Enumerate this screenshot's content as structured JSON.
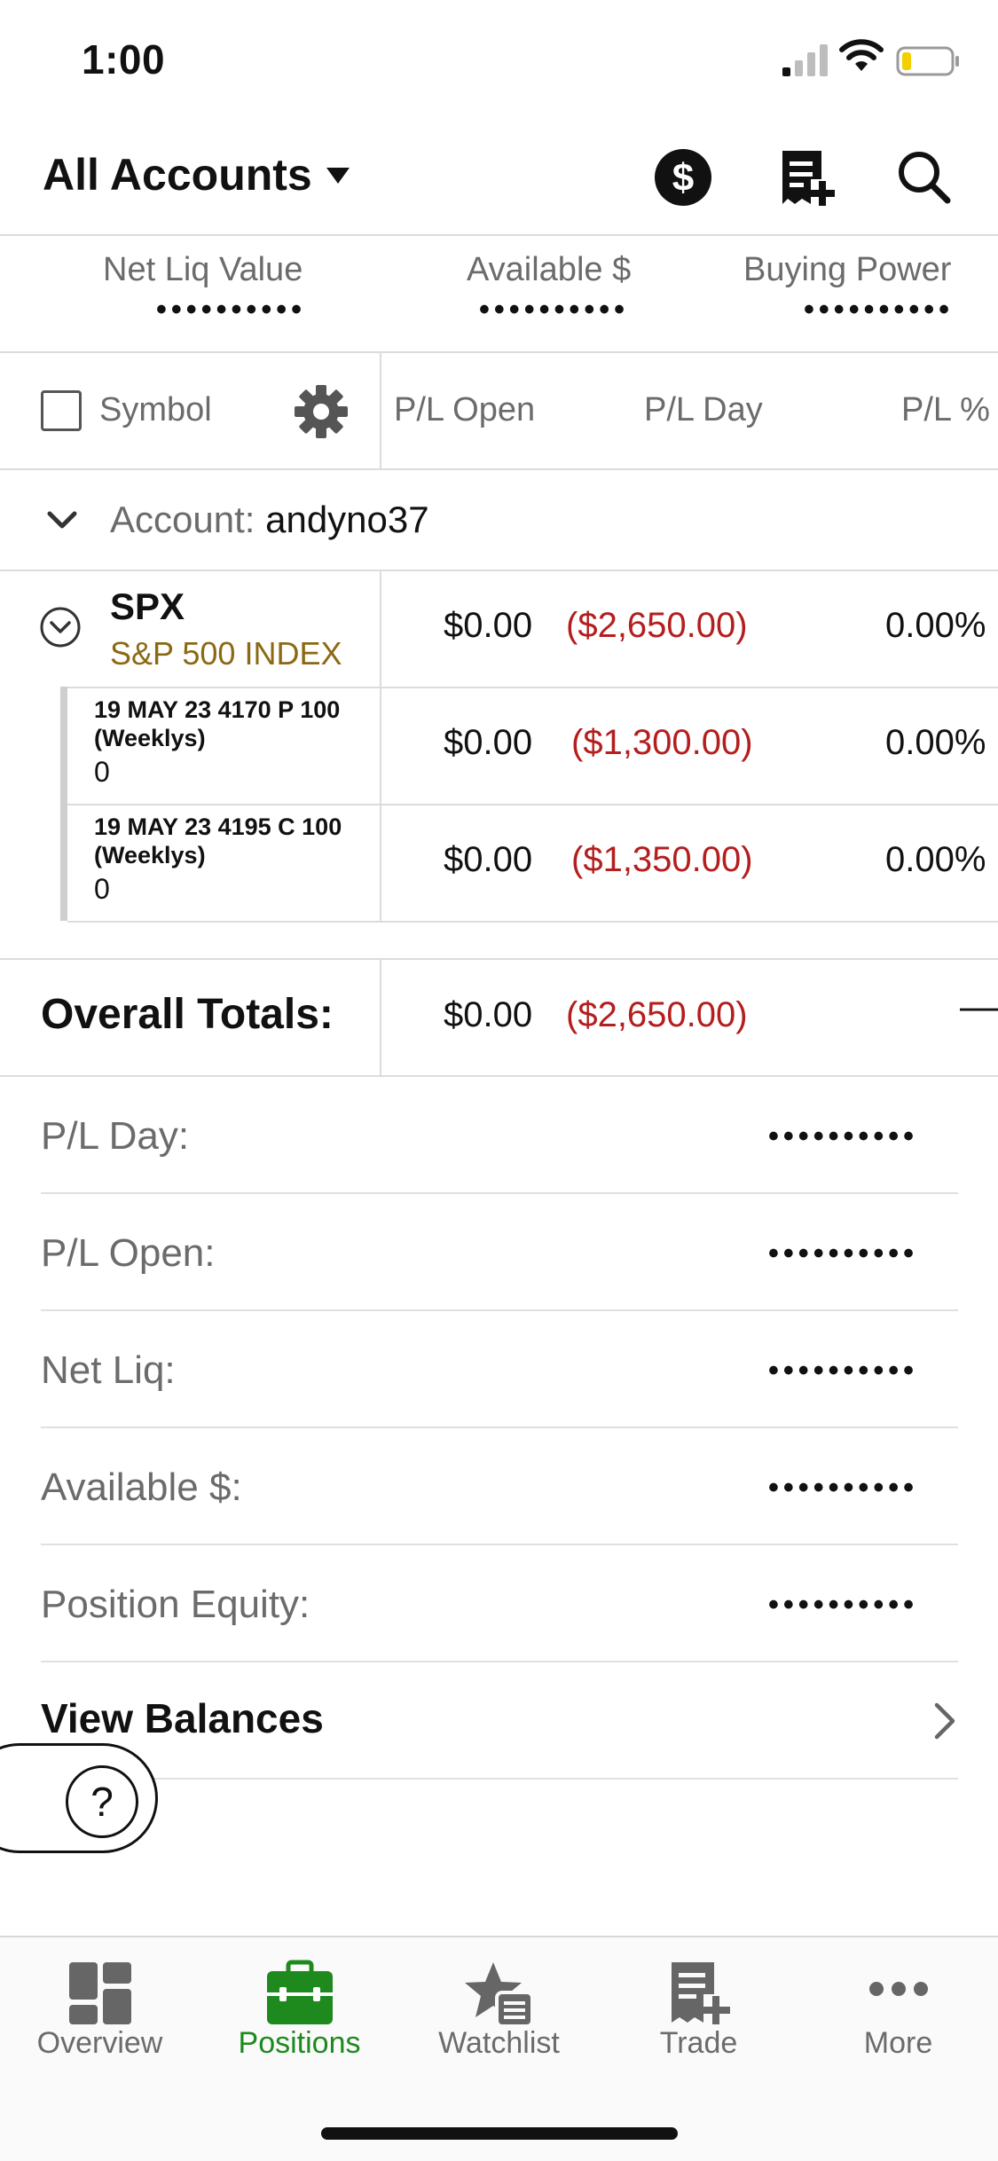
{
  "status_bar": {
    "time": "1:00"
  },
  "header": {
    "account_selector": "All Accounts"
  },
  "summary": [
    {
      "label": "Net Liq Value",
      "value": "••••••••••"
    },
    {
      "label": "Available $",
      "value": "••••••••••"
    },
    {
      "label": "Buying Power",
      "value": "••••••••••"
    }
  ],
  "columns": {
    "symbol": "Symbol",
    "pl_open": "P/L Open",
    "pl_day": "P/L Day",
    "pl_pct": "P/L %"
  },
  "account_row": {
    "prefix": "Account:",
    "name": "andyno37"
  },
  "position": {
    "symbol": "SPX",
    "description": "S&P 500 INDEX",
    "pl_open": "$0.00",
    "pl_day": "($2,650.00)",
    "pl_pct": "0.00%"
  },
  "legs": [
    {
      "title_line1": "19 MAY 23 4170 P 100",
      "title_line2": "(Weeklys)",
      "qty": "0",
      "pl_open": "$0.00",
      "pl_day": "($1,300.00)",
      "pl_pct": "0.00%"
    },
    {
      "title_line1": "19 MAY 23 4195 C 100",
      "title_line2": "(Weeklys)",
      "qty": "0",
      "pl_open": "$0.00",
      "pl_day": "($1,350.00)",
      "pl_pct": "0.00%"
    }
  ],
  "totals": {
    "label": "Overall Totals:",
    "pl_open": "$0.00",
    "pl_day": "($2,650.00)",
    "pl_pct": "—"
  },
  "balances": [
    {
      "label": "P/L Day:",
      "value": "••••••••••"
    },
    {
      "label": "P/L Open:",
      "value": "••••••••••"
    },
    {
      "label": "Net Liq:",
      "value": "••••••••••"
    },
    {
      "label": "Available $:",
      "value": "••••••••••"
    },
    {
      "label": "Position Equity:",
      "value": "••••••••••"
    }
  ],
  "view_balances": "View Balances",
  "help": "?",
  "tabs": [
    {
      "label": "Overview",
      "icon": "overview-icon"
    },
    {
      "label": "Positions",
      "icon": "briefcase-icon",
      "active": true
    },
    {
      "label": "Watchlist",
      "icon": "watchlist-icon"
    },
    {
      "label": "Trade",
      "icon": "trade-icon"
    },
    {
      "label": "More",
      "icon": "more-icon"
    }
  ],
  "colors": {
    "negative": "#b41e1e",
    "active_tab": "#1e8a1e",
    "description": "#8b6914"
  }
}
